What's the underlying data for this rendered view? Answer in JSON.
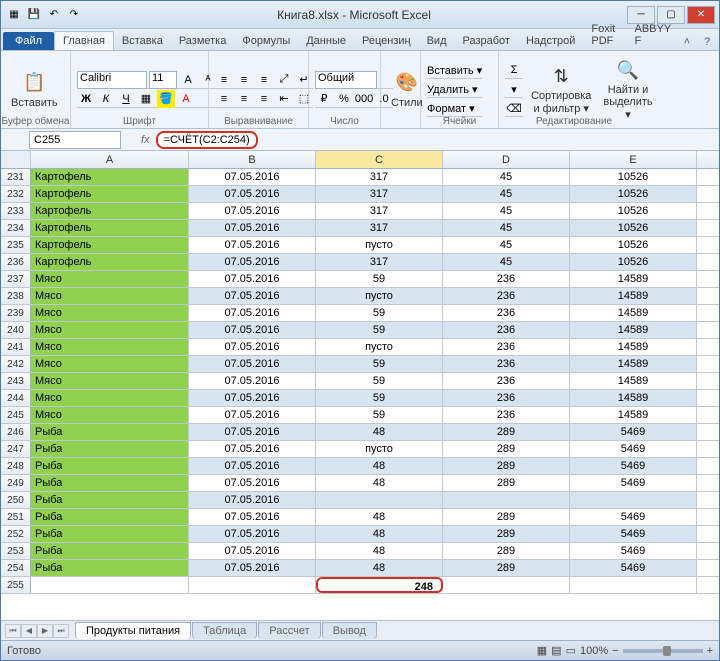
{
  "title": "Книга8.xlsx - Microsoft Excel",
  "tabs": {
    "file": "Файл",
    "home": "Главная",
    "insert": "Вставка",
    "layout": "Разметка",
    "formulas": "Формулы",
    "data": "Данные",
    "review": "Рецензиң",
    "view": "Вид",
    "dev": "Разработ",
    "addins": "Надстрой",
    "foxit": "Foxit PDF",
    "abbyy": "ABBYY F"
  },
  "groups": {
    "clipboard": "Буфер обмена",
    "font": "Шрифт",
    "align": "Выравнивание",
    "number": "Число",
    "styles": "Стили",
    "cells": "Ячейки",
    "editing": "Редактирование"
  },
  "ribbon": {
    "paste": "Вставить",
    "font_name": "Calibri",
    "font_size": "11",
    "number_fmt": "Общий",
    "styles": "Стили",
    "insert": "Вставить ▾",
    "delete": "Удалить ▾",
    "format": "Формат ▾",
    "sort": "Сортировка\nи фильтр ▾",
    "find": "Найти и\nвыделить ▾"
  },
  "namebox": "C255",
  "formula": "=СЧЁТ(C2:C254)",
  "cols": {
    "a": "A",
    "b": "B",
    "c": "C",
    "d": "D",
    "e": "E"
  },
  "rows": [
    {
      "n": 231,
      "a": "Картофель",
      "b": "07.05.2016",
      "c": "317",
      "d": "45",
      "e": "10526",
      "alt": false
    },
    {
      "n": 232,
      "a": "Картофель",
      "b": "07.05.2016",
      "c": "317",
      "d": "45",
      "e": "10526",
      "alt": true
    },
    {
      "n": 233,
      "a": "Картофель",
      "b": "07.05.2016",
      "c": "317",
      "d": "45",
      "e": "10526",
      "alt": false
    },
    {
      "n": 234,
      "a": "Картофель",
      "b": "07.05.2016",
      "c": "317",
      "d": "45",
      "e": "10526",
      "alt": true
    },
    {
      "n": 235,
      "a": "Картофель",
      "b": "07.05.2016",
      "c": "пусто",
      "d": "45",
      "e": "10526",
      "alt": false
    },
    {
      "n": 236,
      "a": "Картофель",
      "b": "07.05.2016",
      "c": "317",
      "d": "45",
      "e": "10526",
      "alt": true
    },
    {
      "n": 237,
      "a": "Мясо",
      "b": "07.05.2016",
      "c": "59",
      "d": "236",
      "e": "14589",
      "alt": false
    },
    {
      "n": 238,
      "a": "Мясо",
      "b": "07.05.2016",
      "c": "пусто",
      "d": "236",
      "e": "14589",
      "alt": true
    },
    {
      "n": 239,
      "a": "Мясо",
      "b": "07.05.2016",
      "c": "59",
      "d": "236",
      "e": "14589",
      "alt": false
    },
    {
      "n": 240,
      "a": "Мясо",
      "b": "07.05.2016",
      "c": "59",
      "d": "236",
      "e": "14589",
      "alt": true
    },
    {
      "n": 241,
      "a": "Мясо",
      "b": "07.05.2016",
      "c": "пусто",
      "d": "236",
      "e": "14589",
      "alt": false
    },
    {
      "n": 242,
      "a": "Мясо",
      "b": "07.05.2016",
      "c": "59",
      "d": "236",
      "e": "14589",
      "alt": true
    },
    {
      "n": 243,
      "a": "Мясо",
      "b": "07.05.2016",
      "c": "59",
      "d": "236",
      "e": "14589",
      "alt": false
    },
    {
      "n": 244,
      "a": "Мясо",
      "b": "07.05.2016",
      "c": "59",
      "d": "236",
      "e": "14589",
      "alt": true
    },
    {
      "n": 245,
      "a": "Мясо",
      "b": "07.05.2016",
      "c": "59",
      "d": "236",
      "e": "14589",
      "alt": false
    },
    {
      "n": 246,
      "a": "Рыба",
      "b": "07.05.2016",
      "c": "48",
      "d": "289",
      "e": "5469",
      "alt": true
    },
    {
      "n": 247,
      "a": "Рыба",
      "b": "07.05.2016",
      "c": "пусто",
      "d": "289",
      "e": "5469",
      "alt": false
    },
    {
      "n": 248,
      "a": "Рыба",
      "b": "07.05.2016",
      "c": "48",
      "d": "289",
      "e": "5469",
      "alt": true
    },
    {
      "n": 249,
      "a": "Рыба",
      "b": "07.05.2016",
      "c": "48",
      "d": "289",
      "e": "5469",
      "alt": false
    },
    {
      "n": 250,
      "a": "Рыба",
      "b": "07.05.2016",
      "c": "",
      "d": "",
      "e": "",
      "alt": true
    },
    {
      "n": 251,
      "a": "Рыба",
      "b": "07.05.2016",
      "c": "48",
      "d": "289",
      "e": "5469",
      "alt": false
    },
    {
      "n": 252,
      "a": "Рыба",
      "b": "07.05.2016",
      "c": "48",
      "d": "289",
      "e": "5469",
      "alt": true
    },
    {
      "n": 253,
      "a": "Рыба",
      "b": "07.05.2016",
      "c": "48",
      "d": "289",
      "e": "5469",
      "alt": false
    },
    {
      "n": 254,
      "a": "Рыба",
      "b": "07.05.2016",
      "c": "48",
      "d": "289",
      "e": "5469",
      "alt": true
    }
  ],
  "result_row": {
    "n": 255,
    "c": "248"
  },
  "sheets": {
    "s1": "Продукты питания",
    "s2": "Таблица",
    "s3": "Рассчет",
    "s4": "Вывод"
  },
  "status": "Готово",
  "zoom": "100%"
}
